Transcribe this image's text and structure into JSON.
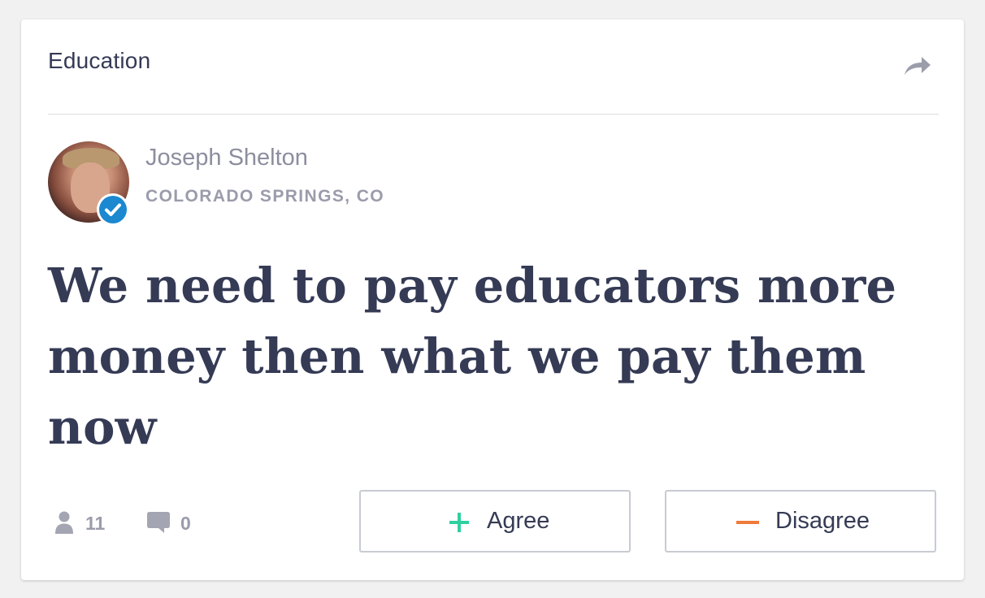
{
  "card": {
    "category": "Education",
    "share_icon": "share-arrow-icon",
    "author": {
      "name": "Joseph Shelton",
      "location": "COLORADO SPRINGS, CO",
      "verified": true,
      "verified_color": "#1b88d0"
    },
    "statement": "We need to pay educators more money then what we pay them now",
    "stats": {
      "followers_icon": "person-icon",
      "followers": "11",
      "comments_icon": "comment-icon",
      "comments": "0"
    },
    "actions": {
      "agree_label": "Agree",
      "agree_icon": "plus-icon",
      "agree_color": "#2fd0a0",
      "disagree_label": "Disagree",
      "disagree_icon": "minus-icon",
      "disagree_color": "#f07a3a"
    }
  },
  "colors": {
    "text_primary": "#353b55",
    "text_muted": "#8c8e9f",
    "background": "#f1f1f1",
    "card": "#ffffff"
  }
}
